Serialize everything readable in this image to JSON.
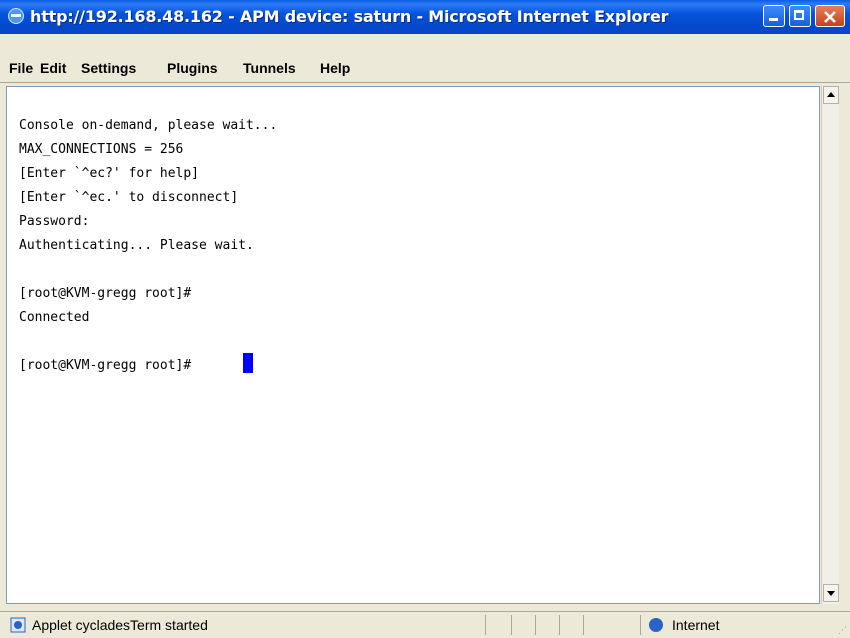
{
  "window": {
    "title": "http://192.168.48.162 - APM device: saturn - Microsoft Internet Explorer",
    "buttons": {
      "minimize": "minimize-icon",
      "maximize": "maximize-icon",
      "close": "close-icon"
    }
  },
  "menu": {
    "items": [
      "File",
      "Edit",
      "Settings",
      "Plugins",
      "Tunnels",
      "Help"
    ]
  },
  "console": {
    "lines": [
      "Console on-demand, please wait...",
      "MAX_CONNECTIONS = 256",
      "[Enter `^ec?' for help]",
      "[Enter `^ec.' to disconnect]",
      "Password:",
      "Authenticating... Please wait.",
      "[root@KVM-gregg root]#",
      "Connected",
      "[root@KVM-gregg root]#"
    ],
    "cursor_color": "#0000ff"
  },
  "status": {
    "text": "Applet cycladesTerm started",
    "zone": "Internet"
  }
}
